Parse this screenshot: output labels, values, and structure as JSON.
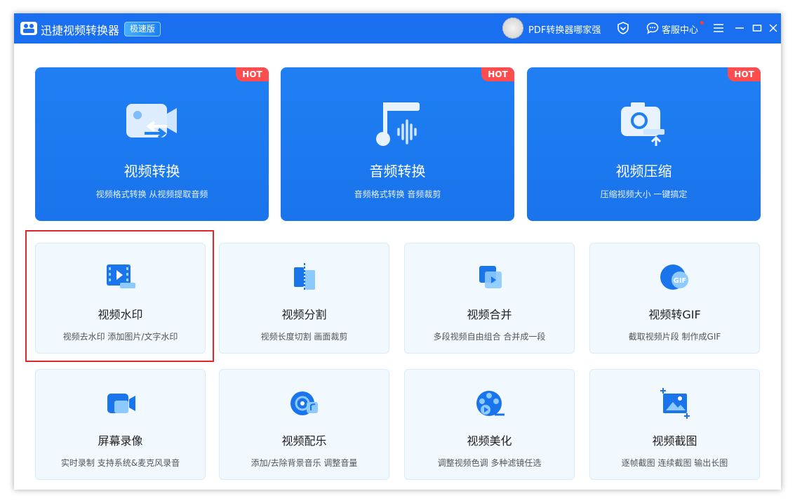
{
  "app": {
    "title": "迅捷视频转换器",
    "edition_badge": "极速版",
    "username": "PDF转换器哪家强",
    "service_label": "客服中心",
    "icons": [
      "app-logo-icon",
      "vip-shield-icon",
      "chat-bubble-icon",
      "menu-icon",
      "minimize-icon",
      "maximize-icon",
      "close-icon"
    ]
  },
  "hot_label": "HOT",
  "featured": [
    {
      "title": "视频转换",
      "subtitle": "视频格式转换 从视频提取音频",
      "icon": "video-convert-icon"
    },
    {
      "title": "音频转换",
      "subtitle": "音频格式转换 音频裁剪",
      "icon": "audio-convert-icon"
    },
    {
      "title": "视频压缩",
      "subtitle": "压缩视频大小 一键搞定",
      "icon": "video-compress-icon"
    }
  ],
  "tools": [
    {
      "title": "视频水印",
      "subtitle": "视频去水印 添加图片/文字水印",
      "icon": "video-watermark-icon"
    },
    {
      "title": "视频分割",
      "subtitle": "视频长度切割 画面裁剪",
      "icon": "video-split-icon"
    },
    {
      "title": "视频合并",
      "subtitle": "多段视频自由组合 合并成一段",
      "icon": "video-merge-icon"
    },
    {
      "title": "视频转GIF",
      "subtitle": "截取视频片段 制作成GIF",
      "icon": "video-gif-icon"
    },
    {
      "title": "屏幕录像",
      "subtitle": "实时录制 支持系统&麦克风录音",
      "icon": "screen-record-icon"
    },
    {
      "title": "视频配乐",
      "subtitle": "添加/去除背景音乐 调整音量",
      "icon": "video-music-icon"
    },
    {
      "title": "视频美化",
      "subtitle": "调整视频色调 多种滤镜任选",
      "icon": "video-beautify-icon"
    },
    {
      "title": "视频截图",
      "subtitle": "逐帧截图 连续截图 输出长图",
      "icon": "video-screenshot-icon"
    }
  ],
  "colors": {
    "titlebar": "#1a6ff0",
    "card_primary": "#1f7ff3",
    "hot": "#ff4d4f",
    "small_card_bg": "#f1f8fe",
    "highlight": "#e0262a"
  }
}
